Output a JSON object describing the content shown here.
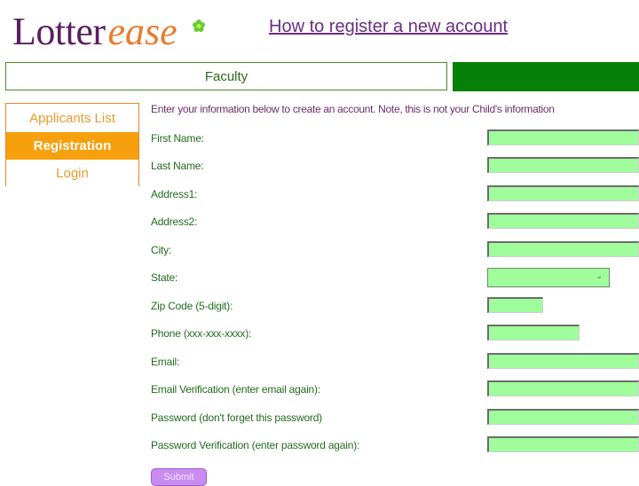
{
  "brand": {
    "name_part1": "Lotter",
    "name_part2": "ease",
    "logo_icon": "flower-icon",
    "colors": {
      "primary": "#5b1f5f",
      "secondary": "#e87b2f",
      "accent": "#66cc33"
    }
  },
  "header": {
    "howto_link": "How to register a new account",
    "faculty_tab": "Faculty",
    "colors": {
      "tab_border": "#4e8a2c",
      "active_bar": "#078007"
    }
  },
  "sidebar": {
    "items": [
      {
        "label": "Applicants List",
        "active": false
      },
      {
        "label": "Registration",
        "active": true
      },
      {
        "label": "Login",
        "active": false
      }
    ],
    "colors": {
      "active_bg": "#f7a00e",
      "text": "#e99a2b"
    }
  },
  "form": {
    "intro": "Enter your information below to create an account. Note, this is not your Child's information",
    "fields": [
      {
        "label": "First Name:",
        "value": ""
      },
      {
        "label": "Last Name:",
        "value": ""
      },
      {
        "label": "Address1:",
        "value": ""
      },
      {
        "label": "Address2:",
        "value": ""
      },
      {
        "label": "City:",
        "value": ""
      },
      {
        "label": "State:",
        "value": "",
        "type": "select"
      },
      {
        "label": "Zip Code (5-digit):",
        "value": ""
      },
      {
        "label": "Phone (xxx-xxx-xxxx):",
        "value": ""
      },
      {
        "label": "Email:",
        "value": ""
      },
      {
        "label": "Email Verification (enter email again):",
        "value": ""
      },
      {
        "label": "Password (don't forget this password)",
        "value": ""
      },
      {
        "label": "Password Verification (enter password again):",
        "value": ""
      }
    ],
    "submit_label": "Submit",
    "colors": {
      "field_bg": "#9ffd9c",
      "label": "#236b1e",
      "intro": "#6b2d6b",
      "submit_bg": "#c98cf0"
    }
  }
}
